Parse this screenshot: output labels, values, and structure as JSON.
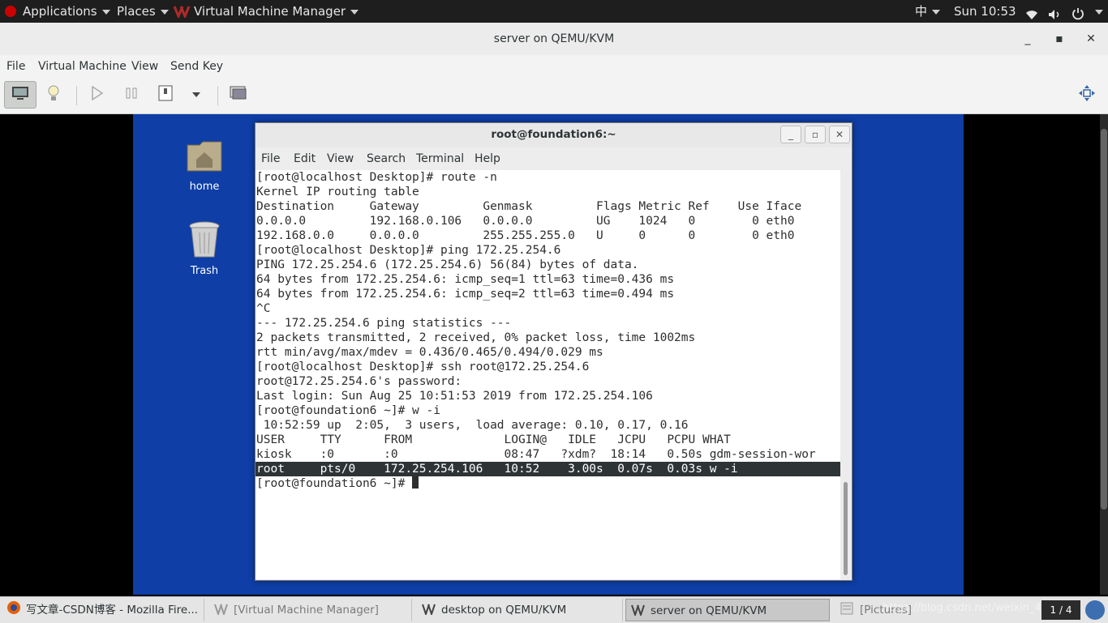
{
  "top_panel": {
    "applications": "Applications",
    "places": "Places",
    "active_app": "Virtual Machine Manager",
    "input_method": "中",
    "clock": "Sun 10:53"
  },
  "vm_window": {
    "title": "server on QEMU/KVM",
    "menu": [
      "File",
      "Virtual Machine",
      "View",
      "Send Key"
    ]
  },
  "desktop": {
    "icons": [
      {
        "label": "home"
      },
      {
        "label": "Trash"
      }
    ]
  },
  "terminal": {
    "title": "root@foundation6:~",
    "menu": [
      "File",
      "Edit",
      "View",
      "Search",
      "Terminal",
      "Help"
    ],
    "lines": [
      "[root@localhost Desktop]# route -n",
      "Kernel IP routing table",
      "Destination     Gateway         Genmask         Flags Metric Ref    Use Iface",
      "0.0.0.0         192.168.0.106   0.0.0.0         UG    1024   0        0 eth0",
      "192.168.0.0     0.0.0.0         255.255.255.0   U     0      0        0 eth0",
      "[root@localhost Desktop]# ping 172.25.254.6",
      "PING 172.25.254.6 (172.25.254.6) 56(84) bytes of data.",
      "64 bytes from 172.25.254.6: icmp_seq=1 ttl=63 time=0.436 ms",
      "64 bytes from 172.25.254.6: icmp_seq=2 ttl=63 time=0.494 ms",
      "^C",
      "--- 172.25.254.6 ping statistics ---",
      "2 packets transmitted, 2 received, 0% packet loss, time 1002ms",
      "rtt min/avg/max/mdev = 0.436/0.465/0.494/0.029 ms",
      "[root@localhost Desktop]# ssh root@172.25.254.6",
      "root@172.25.254.6's password:",
      "Last login: Sun Aug 25 10:51:53 2019 from 172.25.254.106",
      "[root@foundation6 ~]# w -i",
      " 10:52:59 up  2:05,  3 users,  load average: 0.10, 0.17, 0.16",
      "USER     TTY      FROM             LOGIN@   IDLE   JCPU   PCPU WHAT",
      "kiosk    :0       :0               08:47   ?xdm?  18:14   0.50s gdm-session-wor",
      "root     pts/0    172.25.254.106   10:52    3.00s  0.07s  0.03s w -i"
    ],
    "prompt": "[root@foundation6 ~]# "
  },
  "taskbar": {
    "tasks": [
      {
        "label": "写文章-CSDN博客 - Mozilla Fire...",
        "state": "normal"
      },
      {
        "label": "[Virtual Machine Manager]",
        "state": "minimized"
      },
      {
        "label": "desktop on QEMU/KVM",
        "state": "normal"
      },
      {
        "label": "server on QEMU/KVM",
        "state": "active"
      },
      {
        "label": "[Pictures]",
        "state": "minimized"
      }
    ],
    "watermark": "https://blog.csdn.net/weixin_42046",
    "pager": "1 / 4"
  },
  "colors": {
    "guest_desktop": "#0e3ea6",
    "terminal_highlight": "#2e3436"
  }
}
